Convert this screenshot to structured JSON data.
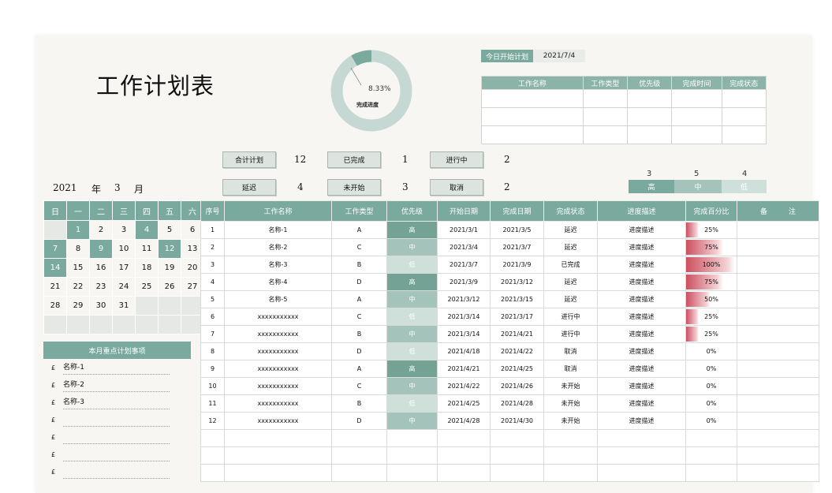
{
  "title": "工作计划表",
  "progress": {
    "percent_text": "8.33%",
    "label": "完成进度",
    "fraction": 0.0833
  },
  "today": {
    "label": "今日开始计划",
    "date": "2021/7/4"
  },
  "today_table": {
    "headers": [
      "工作名称",
      "工作类型",
      "优先级",
      "完成时间",
      "完成状态"
    ]
  },
  "stats": {
    "total_label": "合计计划",
    "total": "12",
    "done_label": "已完成",
    "done": "1",
    "ongoing_label": "进行中",
    "ongoing": "2",
    "delay_label": "延迟",
    "delay": "4",
    "notstarted_label": "未开始",
    "notstarted": "3",
    "cancel_label": "取消",
    "cancel": "2"
  },
  "priority_summary": {
    "high": {
      "label": "高",
      "count": "3"
    },
    "mid": {
      "label": "中",
      "count": "5"
    },
    "low": {
      "label": "低",
      "count": "4"
    }
  },
  "calendar": {
    "year": "2021",
    "year_unit": "年",
    "month": "3",
    "month_unit": "月",
    "weekdays": [
      "日",
      "一",
      "二",
      "三",
      "四",
      "五",
      "六"
    ]
  },
  "focus": {
    "title": "本月重点计划事项",
    "bullet": "£",
    "items": [
      "名称-1",
      "名称-2",
      "名称-3",
      "",
      "",
      "",
      ""
    ]
  },
  "table": {
    "headers": [
      "序号",
      "工作名称",
      "工作类型",
      "优先级",
      "开始日期",
      "完成日期",
      "完成状态",
      "进度描述",
      "完成百分比",
      "备　　　注"
    ],
    "rows": [
      {
        "no": "1",
        "name": "名称-1",
        "type": "A",
        "priority": "高",
        "start": "2021/3/1",
        "end": "2021/3/5",
        "status": "延迟",
        "desc": "进度描述",
        "pct": "25%",
        "pct_value": 0.25
      },
      {
        "no": "2",
        "name": "名称-2",
        "type": "C",
        "priority": "中",
        "start": "2021/3/4",
        "end": "2021/3/7",
        "status": "延迟",
        "desc": "进度描述",
        "pct": "75%",
        "pct_value": 0.75
      },
      {
        "no": "3",
        "name": "名称-3",
        "type": "B",
        "priority": "低",
        "start": "2021/3/7",
        "end": "2021/3/9",
        "status": "已完成",
        "desc": "进度描述",
        "pct": "100%",
        "pct_value": 1.0
      },
      {
        "no": "4",
        "name": "名称-4",
        "type": "D",
        "priority": "高",
        "start": "2021/3/9",
        "end": "2021/3/12",
        "status": "延迟",
        "desc": "进度描述",
        "pct": "75%",
        "pct_value": 0.75
      },
      {
        "no": "5",
        "name": "名称-5",
        "type": "A",
        "priority": "中",
        "start": "2021/3/12",
        "end": "2021/3/15",
        "status": "延迟",
        "desc": "进度描述",
        "pct": "50%",
        "pct_value": 0.5
      },
      {
        "no": "6",
        "name": "xxxxxxxxxxx",
        "type": "C",
        "priority": "低",
        "start": "2021/3/14",
        "end": "2021/3/17",
        "status": "进行中",
        "desc": "进度描述",
        "pct": "25%",
        "pct_value": 0.25
      },
      {
        "no": "7",
        "name": "xxxxxxxxxxx",
        "type": "B",
        "priority": "中",
        "start": "2021/3/14",
        "end": "2021/4/21",
        "status": "进行中",
        "desc": "进度描述",
        "pct": "25%",
        "pct_value": 0.25
      },
      {
        "no": "8",
        "name": "xxxxxxxxxxx",
        "type": "D",
        "priority": "低",
        "start": "2021/4/18",
        "end": "2021/4/22",
        "status": "取消",
        "desc": "进度描述",
        "pct": "0%",
        "pct_value": 0
      },
      {
        "no": "9",
        "name": "xxxxxxxxxxx",
        "type": "A",
        "priority": "高",
        "start": "2021/4/21",
        "end": "2021/4/25",
        "status": "取消",
        "desc": "进度描述",
        "pct": "0%",
        "pct_value": 0
      },
      {
        "no": "10",
        "name": "xxxxxxxxxxx",
        "type": "C",
        "priority": "中",
        "start": "2021/4/22",
        "end": "2021/4/26",
        "status": "未开始",
        "desc": "进度描述",
        "pct": "0%",
        "pct_value": 0
      },
      {
        "no": "11",
        "name": "xxxxxxxxxxx",
        "type": "B",
        "priority": "低",
        "start": "2021/4/25",
        "end": "2021/4/28",
        "status": "未开始",
        "desc": "进度描述",
        "pct": "0%",
        "pct_value": 0
      },
      {
        "no": "12",
        "name": "xxxxxxxxxxx",
        "type": "D",
        "priority": "中",
        "start": "2021/4/28",
        "end": "2021/4/30",
        "status": "未开始",
        "desc": "进度描述",
        "pct": "0%",
        "pct_value": 0
      }
    ]
  },
  "colors": {
    "accent": "#7aa99e",
    "bar": "#cc5060"
  }
}
